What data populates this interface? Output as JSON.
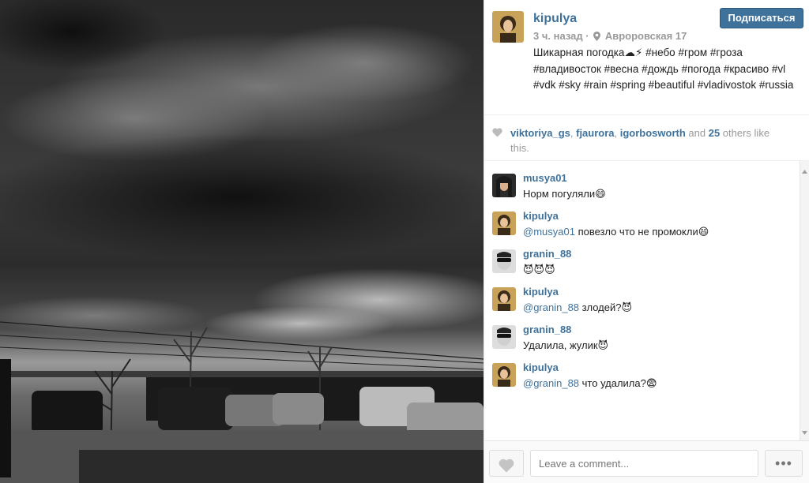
{
  "post": {
    "username": "kipulya",
    "time": "3 ч. назад",
    "separator": "·",
    "location": "Авроровская 17",
    "caption": "Шикарная погодка☁⚡ #небо #гром #гроза #владивосток #весна #дождь #погода #красиво #vl #vdk #sky #rain #spring #beautiful #vladivostok #russia",
    "follow_label": "Подписаться"
  },
  "likes": {
    "users": [
      "viktoriya_gs",
      "fjaurora",
      "igorbosworth"
    ],
    "sep1": ", ",
    "sep2": ", ",
    "and_text": " and ",
    "count": "25",
    "others_text": " others like this."
  },
  "comments": [
    {
      "user": "musya01",
      "mention": "",
      "text": "Норм погуляли😄"
    },
    {
      "user": "kipulya",
      "mention": "@musya01",
      "text": " повезло что не промокли😄"
    },
    {
      "user": "granin_88",
      "mention": "",
      "text": "😈😈😈"
    },
    {
      "user": "kipulya",
      "mention": "@granin_88",
      "text": " злодей?😈"
    },
    {
      "user": "granin_88",
      "mention": "",
      "text": "Удалила, жулик😈"
    },
    {
      "user": "kipulya",
      "mention": "@granin_88",
      "text": " что удалила?😨"
    }
  ],
  "footer": {
    "comment_placeholder": "Leave a comment...",
    "more_label": "•••"
  },
  "icons": {
    "location": "pin-icon",
    "like": "heart-icon",
    "more": "more-dots-icon"
  },
  "colors": {
    "link": "#3f729b",
    "follow_bg": "#3f729b",
    "muted": "#999999"
  }
}
